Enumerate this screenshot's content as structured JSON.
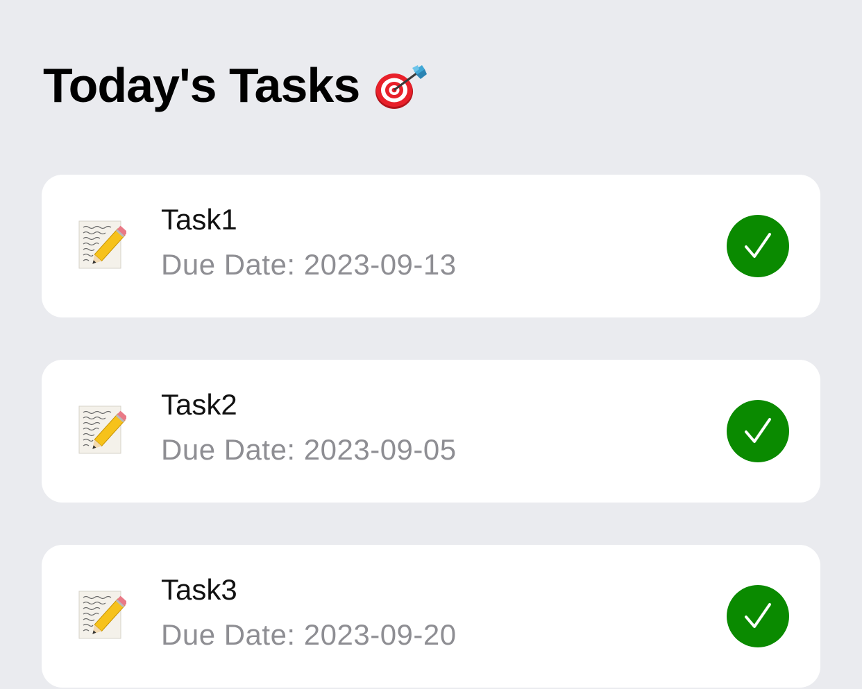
{
  "header": {
    "title": "Today's Tasks",
    "title_icon": "direct-hit-icon"
  },
  "tasks": [
    {
      "name": "Task1",
      "due": "Due Date: 2023-09-13",
      "icon": "memo-icon",
      "completed": true
    },
    {
      "name": "Task2",
      "due": "Due Date: 2023-09-05",
      "icon": "memo-icon",
      "completed": true
    },
    {
      "name": "Task3",
      "due": "Due Date: 2023-09-20",
      "icon": "memo-icon",
      "completed": true
    }
  ],
  "colors": {
    "background": "#EAEBEF",
    "card": "#FFFFFF",
    "complete_accent": "#0A8A00",
    "secondary_text": "#8E8E93"
  }
}
